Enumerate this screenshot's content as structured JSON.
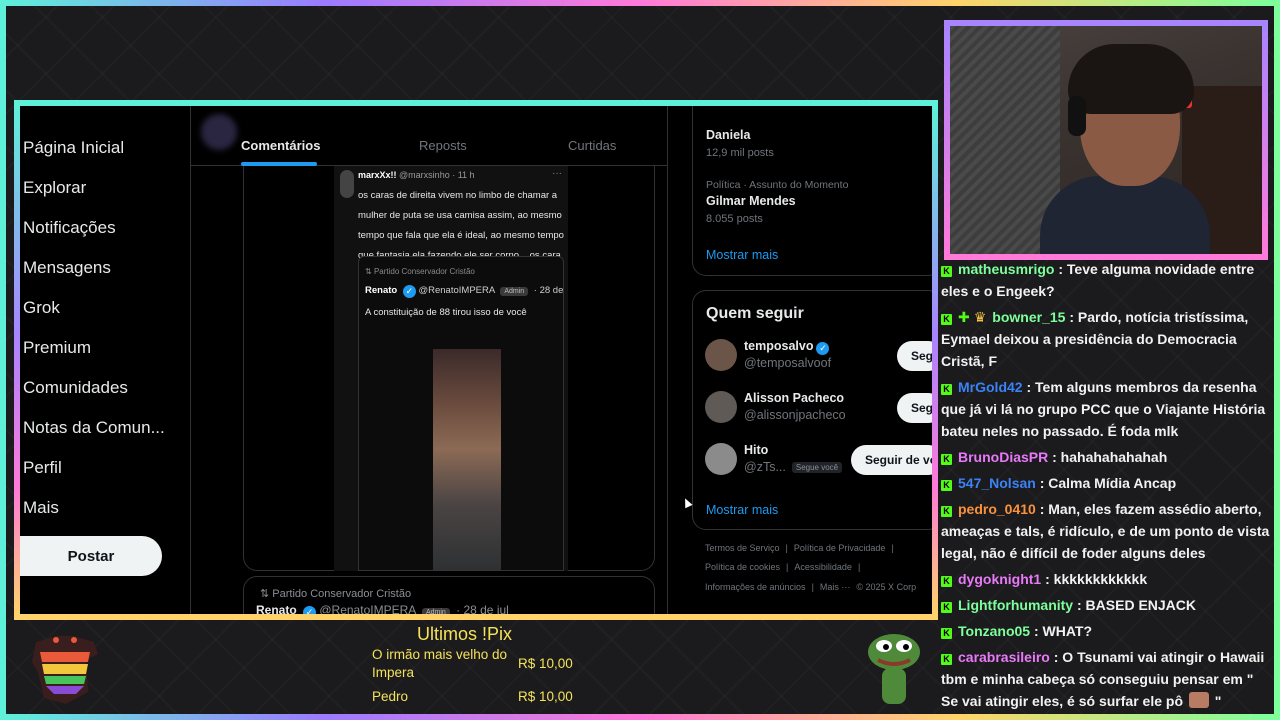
{
  "nav": {
    "items": [
      "Página Inicial",
      "Explorar",
      "Notificações",
      "Mensagens",
      "Grok",
      "Premium",
      "Comunidades",
      "Notas da Comun...",
      "Perfil",
      "Mais"
    ],
    "post_button": "Postar"
  },
  "tabs": [
    "Comentários",
    "Reposts",
    "Curtidas"
  ],
  "embedded_tweet": {
    "author": "marxXx!!",
    "handle_time": "@marxsinho · 11 h",
    "text": "os caras de direita vivem no limbo de chamar a mulher de puta se usa camisa assim, ao mesmo tempo que fala que ela é ideal, ao mesmo tempo que fantasia ela fazendo ele ser corno... os cara são muito maluco",
    "quote": {
      "party": "Partido Conservador Cristão",
      "author": "Renato",
      "handle": "@RenatoIMPERA",
      "badge": "Admin",
      "date": "· 28 de jul",
      "text": "A constituição de 88 tirou isso de você"
    }
  },
  "next_post": {
    "party": "Partido Conservador Cristão",
    "author": "Renato",
    "handle": "@RenatoIMPERA",
    "badge": "Admin",
    "date": "· 28 de jul"
  },
  "trends": {
    "item1_name": "Daniela",
    "item1_posts": "12,9 mil posts",
    "item2_context": "Política · Assunto do Momento",
    "item2_name": "Gilmar Mendes",
    "item2_posts": "8.055 posts",
    "show_more": "Mostrar mais"
  },
  "who_to_follow": {
    "title": "Quem seguir",
    "users": [
      {
        "name": "temposalvo",
        "handle": "@temposalvoof",
        "button": "Segu"
      },
      {
        "name": "Alisson Pacheco",
        "handle": "@alissonjpacheco",
        "button": "Segu"
      },
      {
        "name": "Hito",
        "handle": "@zTs...",
        "follows_you": "Segue você",
        "button": "Seguir de vo"
      }
    ],
    "show_more": "Mostrar mais"
  },
  "footer": {
    "line1": [
      "Termos de Serviço",
      "|",
      "Política de Privacidade",
      "|"
    ],
    "line2": [
      "Política de cookies",
      "|",
      "Acessibilidade",
      "|"
    ],
    "line3": [
      "Informações de anúncios",
      "|",
      "Mais ···",
      "© 2025 X Corp"
    ]
  },
  "chat": [
    {
      "user": "matheusmrigo",
      "color": "#7dff9b",
      "text": ": Teve alguma novidade entre eles e o Engeek?"
    },
    {
      "user": "bowner_15",
      "color": "#7dff9b",
      "extra": true,
      "text": ": Pardo, notícia tristíssima, Eymael deixou a presidência do Democracia Cristã, F"
    },
    {
      "user": "MrGold42",
      "color": "#3b82f6",
      "text": ": Tem alguns membros da resenha que já vi lá no grupo PCC que o Viajante História bateu neles no passado. É foda mlk"
    },
    {
      "user": "BrunoDiasPR",
      "color": "#e879f9",
      "text": ": hahahahahahah"
    },
    {
      "user": "547_Nolsan",
      "color": "#3b82f6",
      "text": ": Calma Mídia Ancap"
    },
    {
      "user": "pedro_0410",
      "color": "#fb923c",
      "text": ": Man, eles fazem assédio aberto, ameaças e tals, é ridículo, e de um ponto de vista legal, não é difícil de foder alguns deles"
    },
    {
      "user": "dygoknight1",
      "color": "#e879f9",
      "text": ": kkkkkkkkkkkk"
    },
    {
      "user": "Lightforhumanity",
      "color": "#7dff9b",
      "text": ": BASED ENJACK"
    },
    {
      "user": "Tonzano05",
      "color": "#7dff9b",
      "text": ": WHAT?"
    },
    {
      "user": "carabrasileiro",
      "color": "#e879f9",
      "text": ": O Tsunami vai atingir o Hawaii tbm e minha cabeça só conseguiu pensar em \" Se vai atingir eles, é só surfar ele pô",
      "emote": true,
      "tail": "\""
    }
  ],
  "pix": {
    "title": "Ultimos !Pix",
    "entries": [
      {
        "name": "O irmão mais velho do Impera",
        "value": "R$ 10,00"
      },
      {
        "name": "Pedro",
        "value": "R$ 10,00"
      }
    ]
  }
}
